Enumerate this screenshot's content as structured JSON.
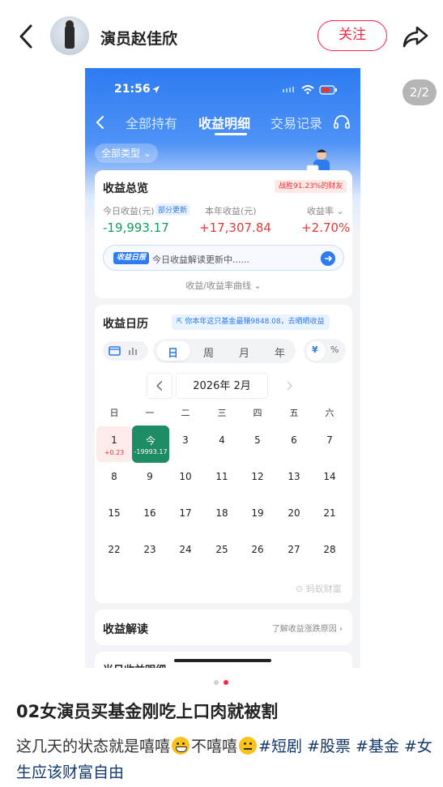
{
  "header": {
    "author_name": "演员赵佳欣",
    "follow_label": "关注"
  },
  "pager": {
    "badge": "2/2",
    "current": 2,
    "total": 2
  },
  "screenshot": {
    "status_time": "21:56",
    "tabs": [
      "全部持有",
      "收益明细",
      "交易记录"
    ],
    "active_tab": "收益明细",
    "type_filter": "全部类型",
    "overview": {
      "title": "收益总览",
      "rank_badge": "战胜91.23%的财友",
      "today_label": "今日收益(元)",
      "today_partial": "部分更新",
      "today_value": "-19,993.17",
      "year_label": "本年收益(元)",
      "year_value": "+17,307.84",
      "rate_label": "收益率",
      "rate_value": "+2.70%",
      "brief_tag": "收益日报",
      "brief_text": "今日收益解读更新中......",
      "curve_link": "收益/收益率曲线"
    },
    "calendar": {
      "title": "收益日历",
      "promo": "你本年这只基金最赚9848.08，去晒晒收益",
      "periods": [
        "日",
        "周",
        "月",
        "年"
      ],
      "active_period": "日",
      "units": [
        "¥",
        "%"
      ],
      "active_unit": "¥",
      "month": "2026年 2月",
      "weekdays": [
        "日",
        "一",
        "二",
        "三",
        "四",
        "五",
        "六"
      ],
      "day1_num": "1",
      "day1_gain": "+0.23",
      "today_label": "今",
      "today_value": "-19993.17",
      "days": [
        "3",
        "4",
        "5",
        "6",
        "7",
        "8",
        "9",
        "10",
        "11",
        "12",
        "13",
        "14",
        "15",
        "16",
        "17",
        "18",
        "19",
        "20",
        "21",
        "22",
        "23",
        "24",
        "25",
        "26",
        "27",
        "28"
      ],
      "watermark": "蚂蚁财富"
    },
    "interpretation": {
      "title": "收益解读",
      "link": "了解收益涨跌原因"
    },
    "next_card_title": "当日收益明细"
  },
  "post": {
    "title": "02女演员买基金刚吃上口肉就被割",
    "body_part1": "这几天的状态就是嘻嘻",
    "body_part2": "不嘻嘻",
    "hashtags": [
      "#短剧",
      "#股票",
      "#基金",
      "#女生应该财富自由"
    ]
  },
  "colors": {
    "accent_red": "#ff2442",
    "fund_blue": "#2f7bf0",
    "loss_green": "#10a060",
    "gain_red": "#e53935",
    "hashtag": "#13386c"
  },
  "icons": {
    "back": "chevron-left-icon",
    "share": "share-arrow-icon",
    "location": "location-arrow-icon",
    "help": "headset-icon"
  }
}
